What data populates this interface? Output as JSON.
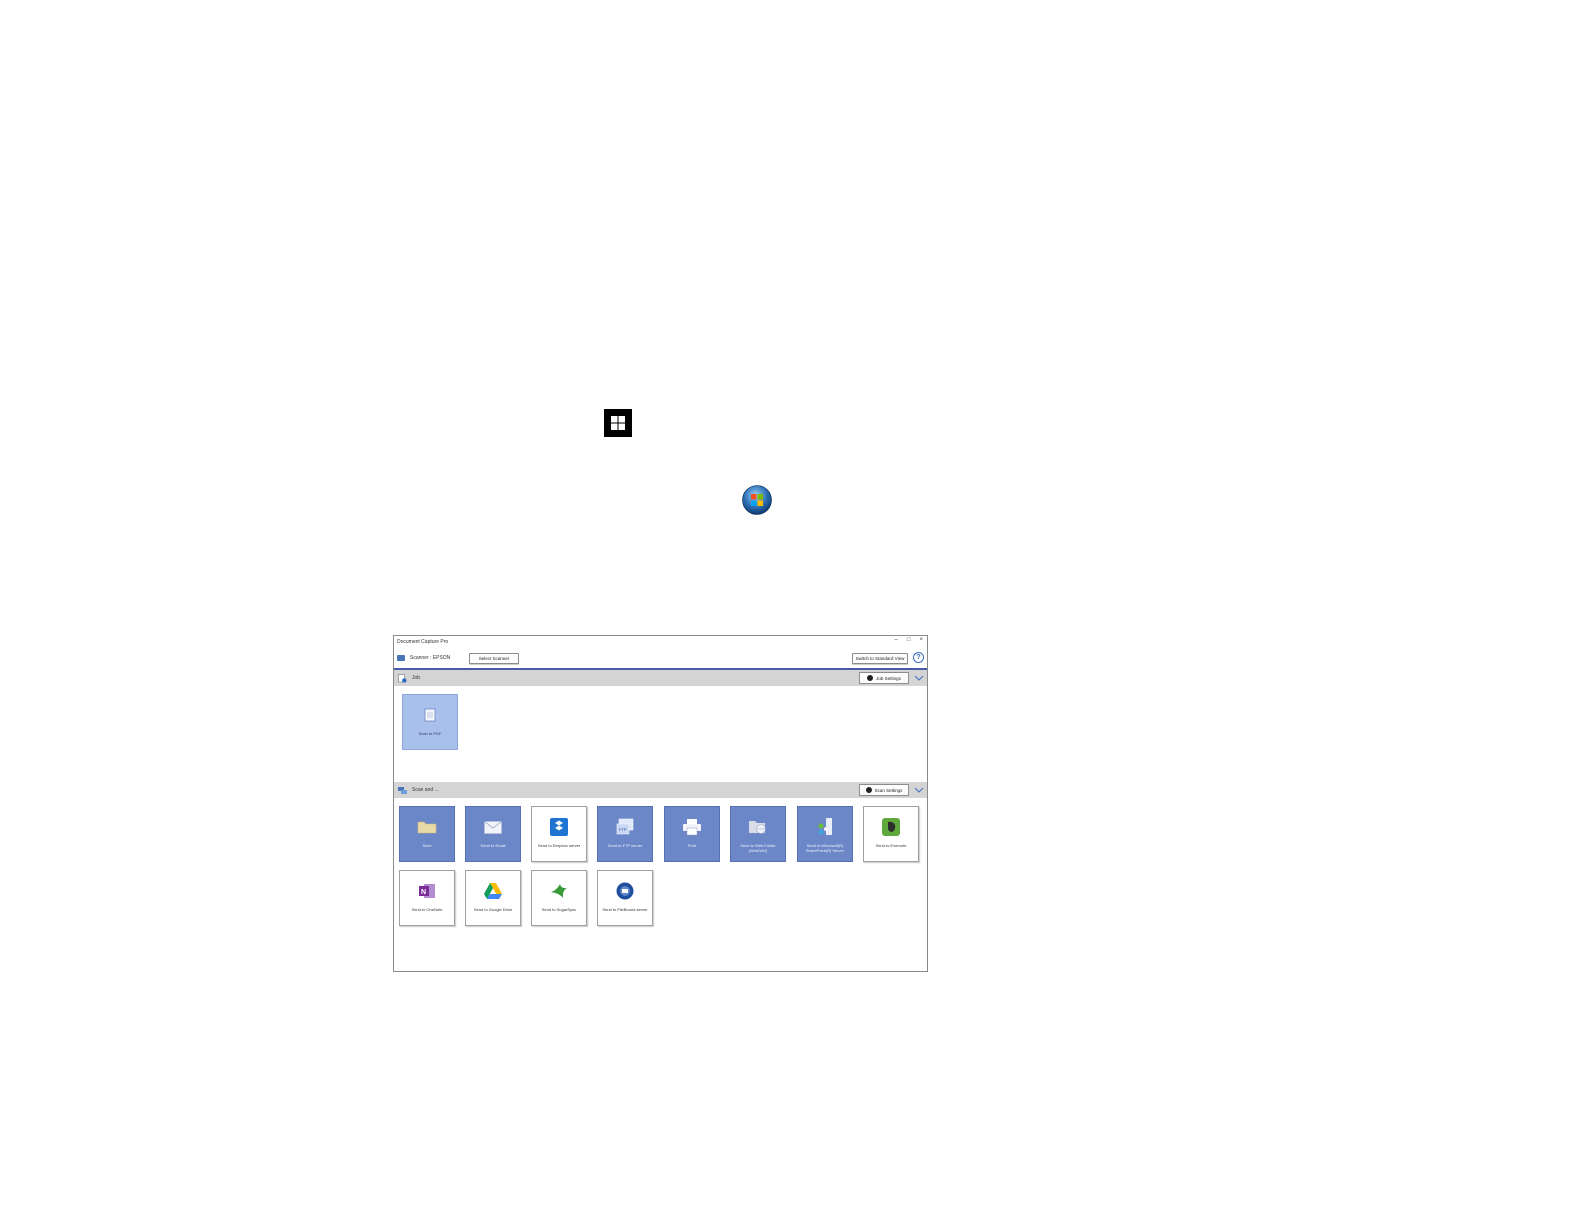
{
  "icons": {
    "windows10_start": "windows-10-start-icon",
    "windows7_start": "windows-7-start-icon"
  },
  "app": {
    "title": "Document Capture Pro",
    "window_controls": {
      "minimize": "–",
      "maximize": "□",
      "close": "×"
    },
    "toolbar": {
      "scanner_label": "Scanner : EPSON",
      "select_scanner": "Select Scanner",
      "switch_view": "Switch to Standard View",
      "help": "?"
    },
    "job_section": {
      "label": "Job",
      "settings_button": "Job Settings",
      "tiles": [
        {
          "label": "Scan to PDF",
          "icon": "document-icon"
        }
      ]
    },
    "scan_section": {
      "label": "Scan and ...",
      "settings_button": "Scan Settings",
      "tiles": [
        {
          "label": "Save",
          "icon": "folder-icon"
        },
        {
          "label": "Send to Email",
          "icon": "envelope-icon"
        },
        {
          "label": "Send to Dropbox server",
          "icon": "dropbox-icon"
        },
        {
          "label": "Send to FTP server",
          "icon": "ftp-icon"
        },
        {
          "label": "Print",
          "icon": "printer-icon"
        },
        {
          "label": "Send to Web Folder (WebDAV)",
          "icon": "web-folder-icon"
        },
        {
          "label": "Send to Microsoft(R) SharePoint(R) Server",
          "icon": "sharepoint-icon"
        },
        {
          "label": "Send to Evernote",
          "icon": "evernote-icon"
        },
        {
          "label": "Send to OneNote",
          "icon": "onenote-icon"
        },
        {
          "label": "Send to Google Drive",
          "icon": "google-drive-icon"
        },
        {
          "label": "Send to SugarSync",
          "icon": "sugarsync-icon"
        },
        {
          "label": "Send to FileBound server",
          "icon": "filebound-icon"
        }
      ]
    }
  },
  "colors": {
    "tile_blue": "#6c87c8",
    "tile_selected": "#a9c0ec",
    "toolbar_rule": "#4a5aa8",
    "section_header": "#d4d4d4"
  }
}
